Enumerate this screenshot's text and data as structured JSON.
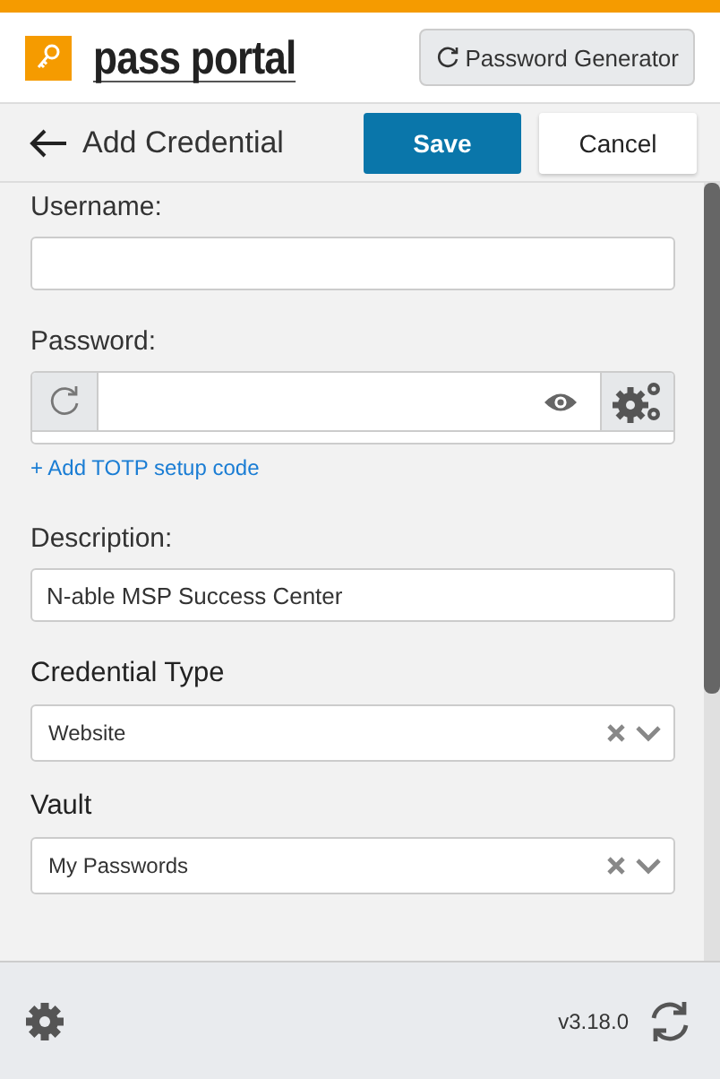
{
  "header": {
    "logo": {
      "word_1": "pass",
      "word_2": "portal"
    },
    "generator_button": "Password Generator"
  },
  "toolbar": {
    "title": "Add Credential",
    "save": "Save",
    "cancel": "Cancel"
  },
  "fields": [
    {
      "kind": "text",
      "label": "Username:"
    },
    {
      "kind": "password",
      "label": "Password:",
      "link": "+ Add TOTP setup code"
    },
    {
      "kind": "text",
      "label": "Description:",
      "value": "N-able MSP Success Center"
    },
    {
      "kind": "select",
      "label": "Credential Type",
      "value": "Website"
    },
    {
      "kind": "select",
      "label": "Vault",
      "value": "My Passwords"
    }
  ],
  "footer": {
    "version": "v3.18.0"
  }
}
